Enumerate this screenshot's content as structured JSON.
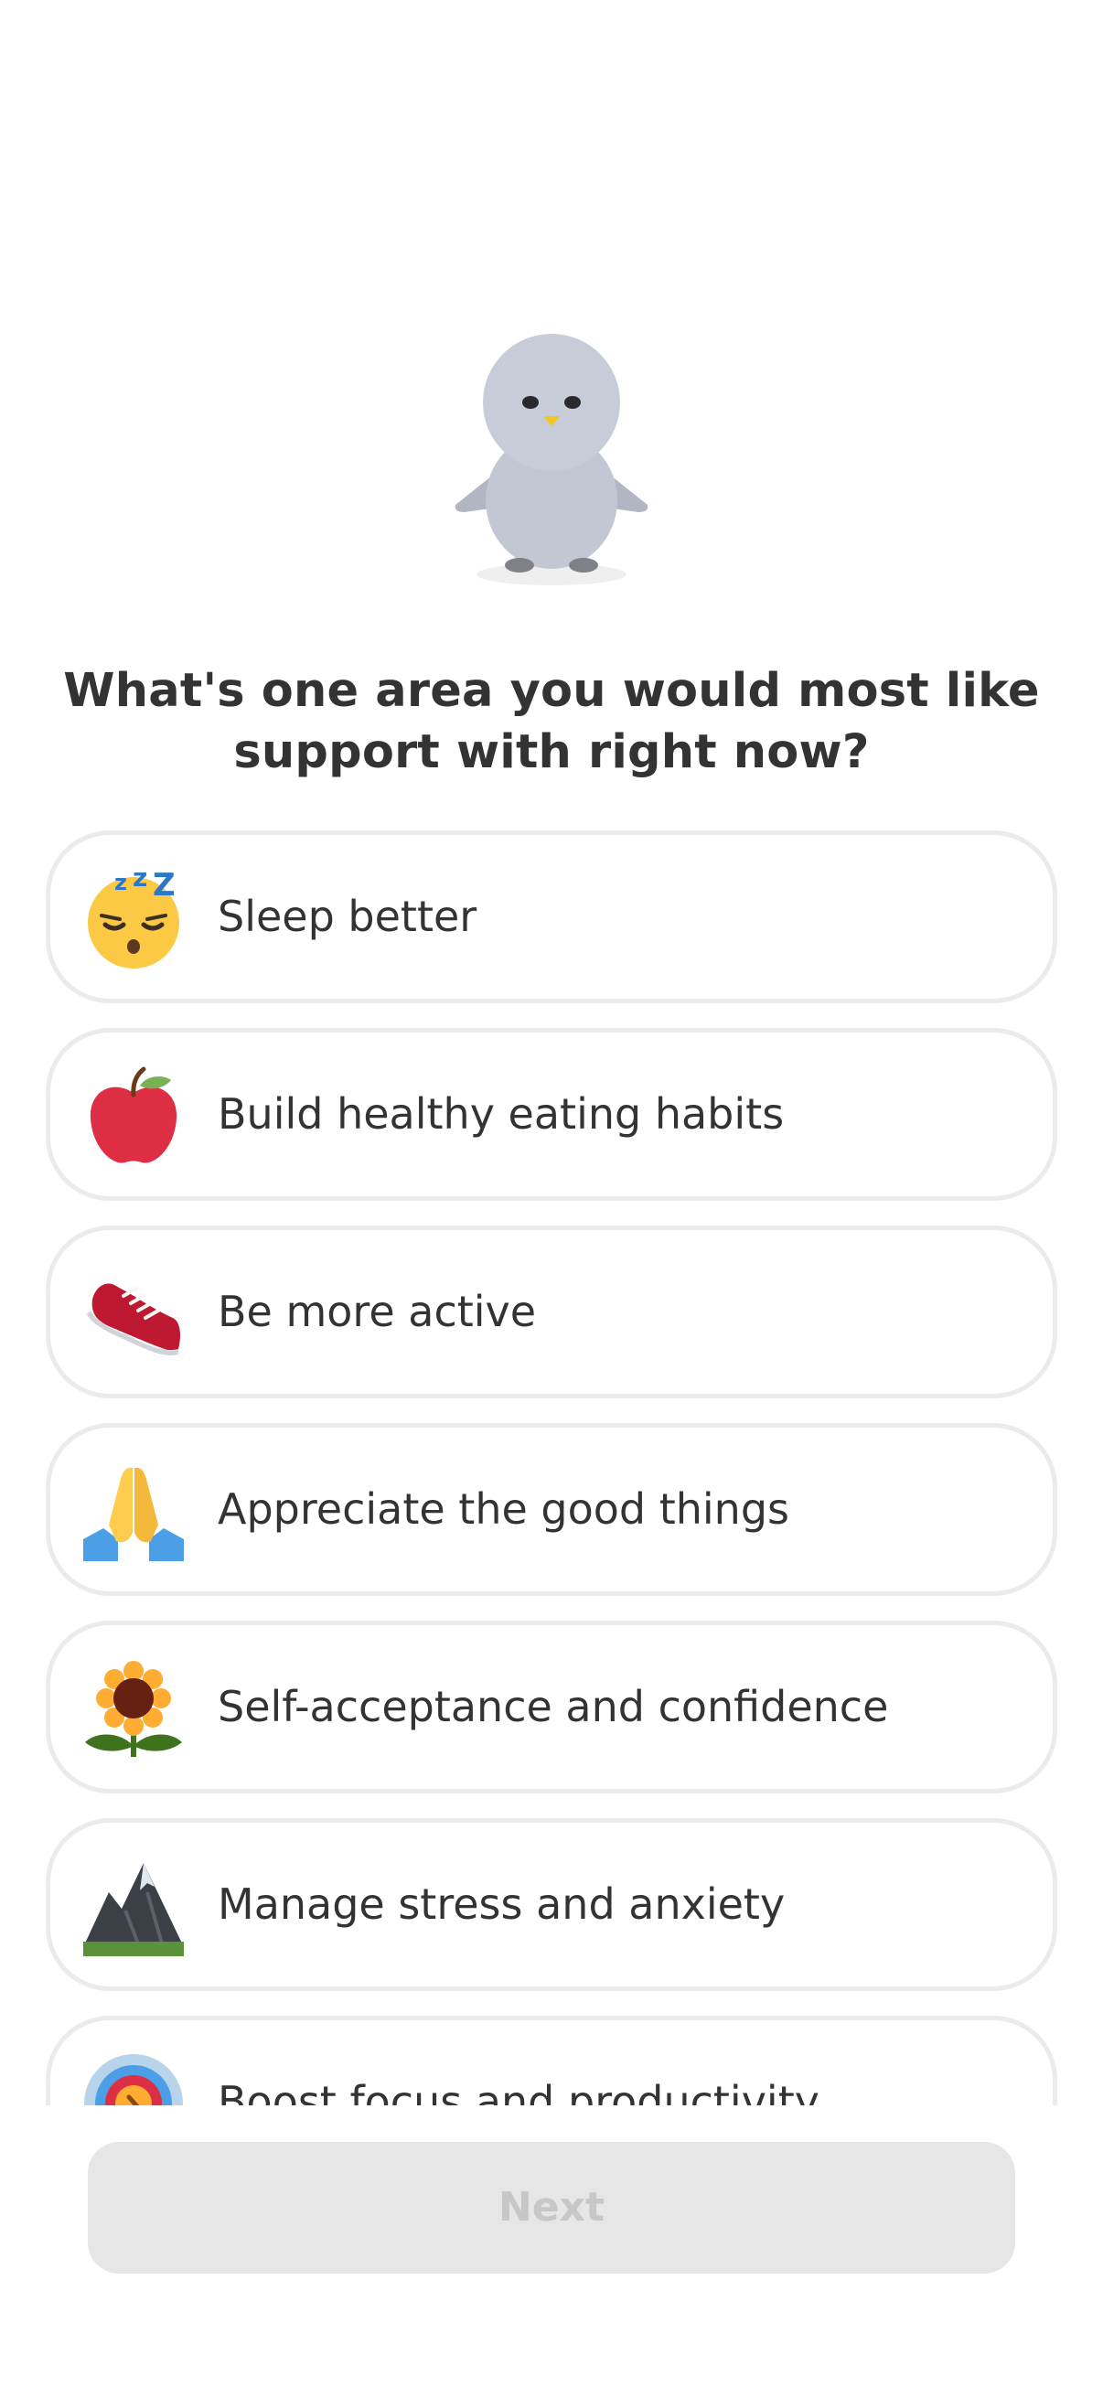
{
  "question": "What's one area you would most like support with right now?",
  "options": [
    {
      "label": "Sleep better",
      "icon": "sleeping-face-icon"
    },
    {
      "label": "Build healthy eating habits",
      "icon": "red-apple-icon"
    },
    {
      "label": "Be more active",
      "icon": "running-shoe-icon"
    },
    {
      "label": "Appreciate the good things",
      "icon": "folded-hands-icon"
    },
    {
      "label": "Self-acceptance and confidence",
      "icon": "sunflower-icon"
    },
    {
      "label": "Manage stress and anxiety",
      "icon": "mountain-icon"
    },
    {
      "label": "Boost focus and productivity",
      "icon": "target-icon"
    }
  ],
  "next_button": {
    "label": "Next",
    "state": "disabled"
  },
  "colors": {
    "text": "#333333",
    "option_border": "#ebebeb",
    "button_bg": "#e6e6e6",
    "button_text": "#c7c7c7",
    "mascot_body": "#c3c6d3"
  }
}
